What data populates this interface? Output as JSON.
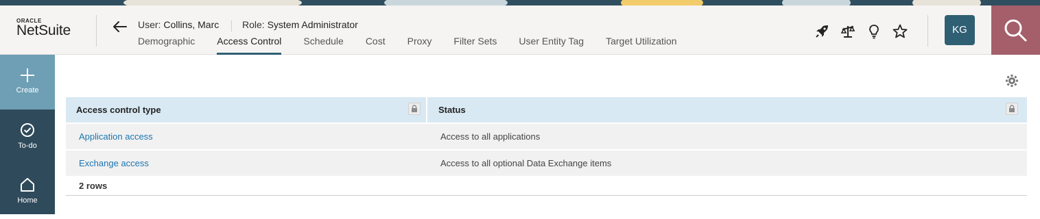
{
  "header": {
    "logo_oracle": "ORACLE",
    "logo_netsuite": "NetSuite",
    "user_label": "User:",
    "user_name": "Collins, Marc",
    "role_label": "Role:",
    "role_name": "System Administrator",
    "tabs": [
      {
        "label": "Demographic"
      },
      {
        "label": "Access Control"
      },
      {
        "label": "Schedule"
      },
      {
        "label": "Cost"
      },
      {
        "label": "Proxy"
      },
      {
        "label": "Filter Sets"
      },
      {
        "label": "User Entity Tag"
      },
      {
        "label": "Target Utilization"
      }
    ],
    "active_tab": "Access Control",
    "avatar_initials": "KG",
    "icons": [
      "rocket-icon",
      "scale-icon",
      "lightbulb-icon",
      "star-icon",
      "search-icon"
    ]
  },
  "sidebar": {
    "items": [
      {
        "label": "Create",
        "icon": "plus-icon"
      },
      {
        "label": "To-do",
        "icon": "check-circle-icon"
      },
      {
        "label": "Home",
        "icon": "home-icon"
      }
    ]
  },
  "table": {
    "columns": [
      "Access control type",
      "Status"
    ],
    "rows": [
      {
        "type": "Application access",
        "status": "Access to all applications"
      },
      {
        "type": "Exchange access",
        "status": "Access to all optional Data Exchange items"
      }
    ],
    "row_count": "2 rows"
  },
  "colors": {
    "accent": "#2f5f73",
    "sidebar": "#2f4a5a",
    "create": "#6e9fb5",
    "search": "#a45f6b",
    "table_header": "#d9e9f3",
    "link": "#1b75b0"
  }
}
